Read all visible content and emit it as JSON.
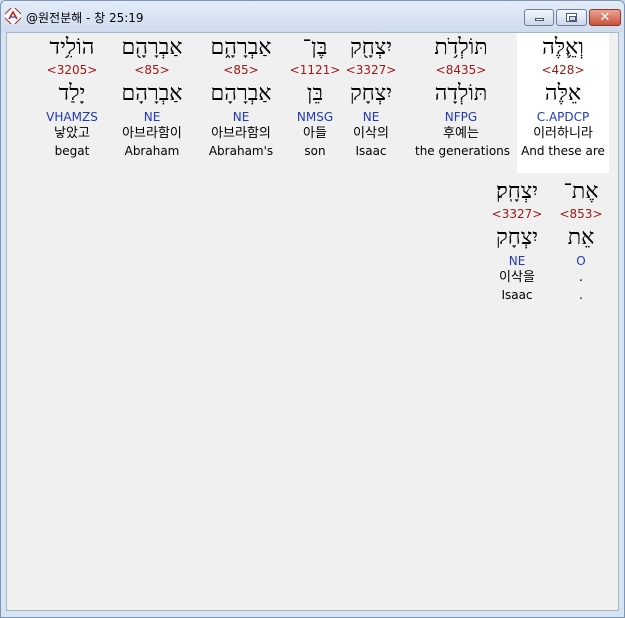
{
  "window": {
    "title": "@원전분해 - 창 25:19",
    "minimize_icon": "minimize-icon",
    "maximize_icon": "maximize-icon",
    "close_icon": "close-icon",
    "close_glyph": "✕"
  },
  "colors": {
    "strong_number": "#a01818",
    "morphology": "#1e3ab8",
    "highlight_background": "#ffffff"
  },
  "rows": [
    {
      "words": [
        {
          "hebrew": "וְאֵ֛לֶּה",
          "strong": "<428>",
          "lemma": "אֵלֶּה",
          "morph": "C.APDCP",
          "korean": "이러하니라",
          "english": "And these are",
          "highlighted": true
        },
        {
          "hebrew": "תּוֹלְדֹ֥ת",
          "strong": "<8435>",
          "lemma": "תּוֹלְדָה",
          "morph": "NFPG",
          "korean": "후예는",
          "english": "the generations",
          "highlighted": false
        },
        {
          "hebrew": "יִצְחָ֖ק",
          "strong": "<3327>",
          "lemma": "יִצְחָק",
          "morph": "NE",
          "korean": "이삭의",
          "english": "Isaac",
          "highlighted": false
        },
        {
          "hebrew": "בֶּן־",
          "strong": "<1121>",
          "lemma": "בֵּן",
          "morph": "NMSG",
          "korean": "아들",
          "english": "son",
          "highlighted": false
        },
        {
          "hebrew": "אַבְרָהָ֑ם",
          "strong": "<85>",
          "lemma": "אַבְרָהָם",
          "morph": "NE",
          "korean": "아브라함의",
          "english": "Abraham's",
          "highlighted": false
        },
        {
          "hebrew": "אַבְרָהָ֖ם",
          "strong": "<85>",
          "lemma": "אַבְרָהָם",
          "morph": "NE",
          "korean": "아브라함이",
          "english": "Abraham",
          "highlighted": false
        },
        {
          "hebrew": "הוֹלִ֥יד",
          "strong": "<3205>",
          "lemma": "יָלַד",
          "morph": "VHAMZS",
          "korean": "낳았고",
          "english": "begat",
          "highlighted": false
        }
      ]
    },
    {
      "words": [
        {
          "hebrew": "אֶת־",
          "strong": "<853>",
          "lemma": "אֵת",
          "morph": "O",
          "korean": ".",
          "english": ".",
          "highlighted": false
        },
        {
          "hebrew": "יִצְחָֽק׃",
          "strong": "<3327>",
          "lemma": "יִצְחָק",
          "morph": "NE",
          "korean": "이삭을",
          "english": "Isaac",
          "highlighted": false
        }
      ]
    }
  ]
}
